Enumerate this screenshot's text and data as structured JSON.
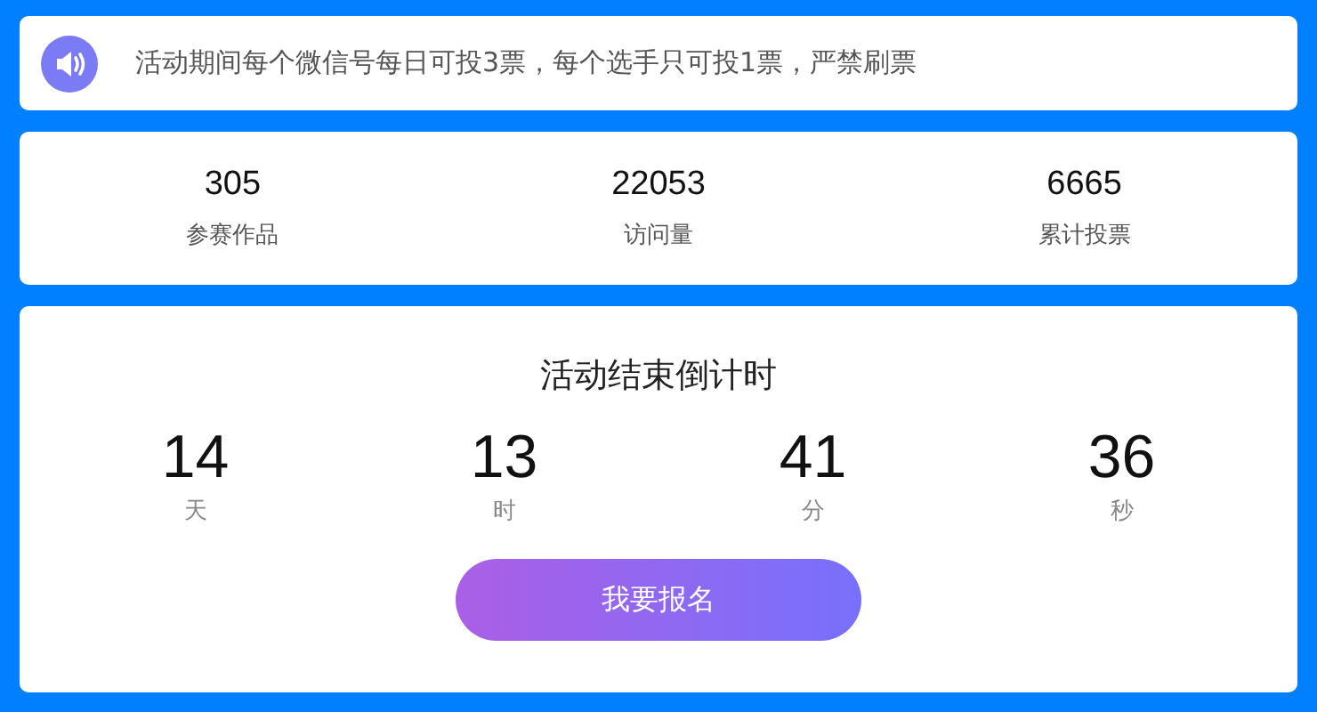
{
  "notice": {
    "text": "活动期间每个微信号每日可投3票，每个选手只可投1票，严禁刷票"
  },
  "stats": [
    {
      "value": "305",
      "label": "参赛作品"
    },
    {
      "value": "22053",
      "label": "访问量"
    },
    {
      "value": "6665",
      "label": "累计投票"
    }
  ],
  "countdown": {
    "title": "活动结束倒计时",
    "units": [
      {
        "value": "14",
        "label": "天"
      },
      {
        "value": "13",
        "label": "时"
      },
      {
        "value": "41",
        "label": "分"
      },
      {
        "value": "36",
        "label": "秒"
      }
    ],
    "button": "我要报名"
  }
}
